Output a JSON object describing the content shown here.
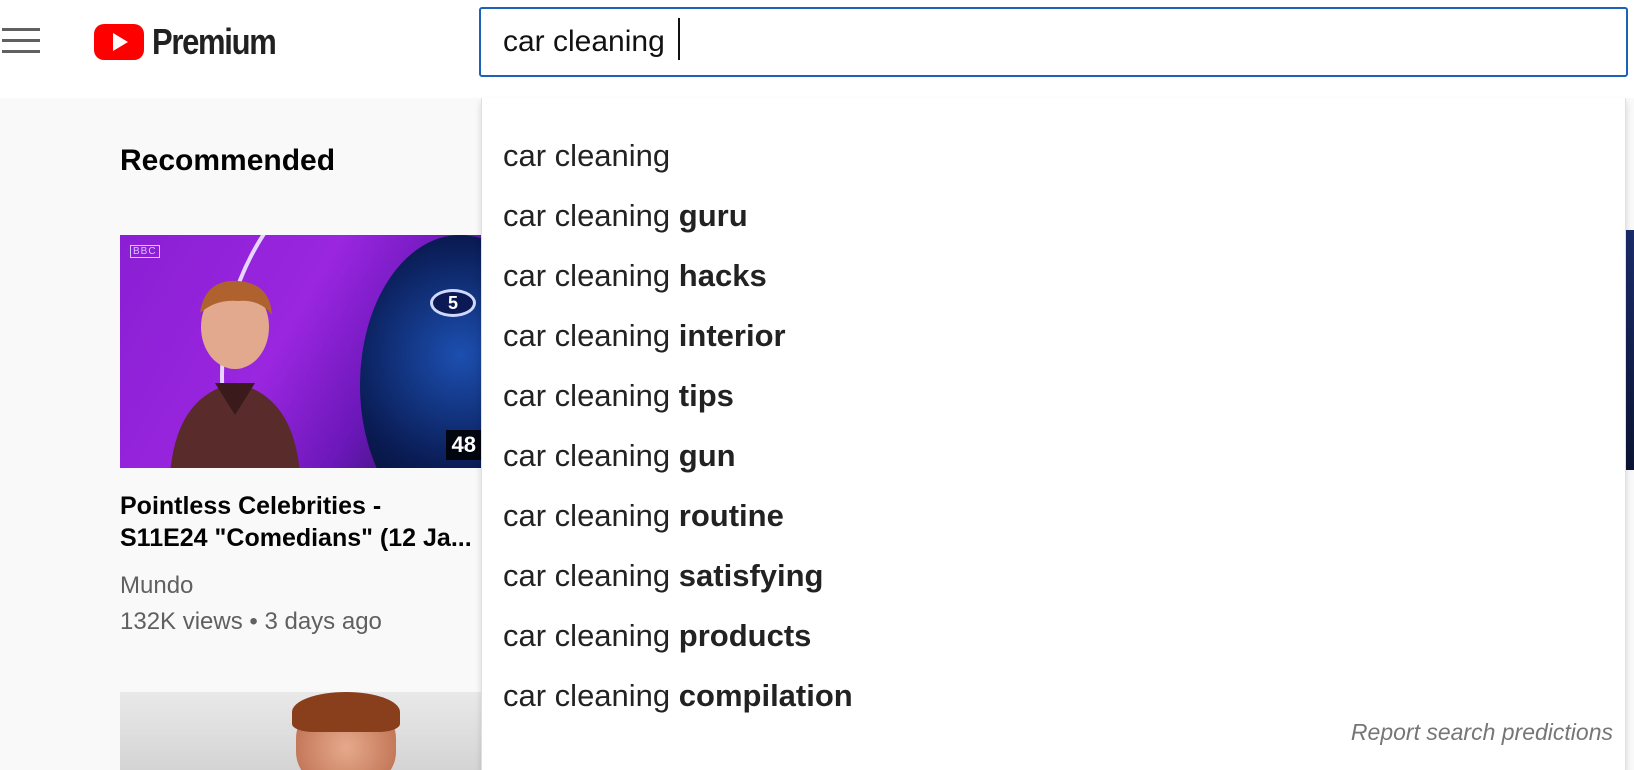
{
  "header": {
    "menu_icon": "hamburger-menu-icon",
    "logo_text": "Premium",
    "search": {
      "value": "car cleaning",
      "placeholder": ""
    }
  },
  "main": {
    "section_title": "Recommended",
    "videos": [
      {
        "title": "Pointless Celebrities - S11E24 \"Comedians\" (12 Ja...",
        "title_line1": "Pointless Celebrities -",
        "title_line2": "S11E24 \"Comedians\" (12 Ja...",
        "channel": "Mundo",
        "meta": "132K views • 3 days ago",
        "duration_partial": "48",
        "thumbnail_badge": "BBC",
        "thumbnail_score": "5"
      }
    ]
  },
  "dropdown": {
    "suggestions": [
      {
        "base": "car cleaning",
        "completion": ""
      },
      {
        "base": "car cleaning ",
        "completion": "guru"
      },
      {
        "base": "car cleaning ",
        "completion": "hacks"
      },
      {
        "base": "car cleaning ",
        "completion": "interior"
      },
      {
        "base": "car cleaning ",
        "completion": "tips"
      },
      {
        "base": "car cleaning ",
        "completion": "gun"
      },
      {
        "base": "car cleaning ",
        "completion": "routine"
      },
      {
        "base": "car cleaning ",
        "completion": "satisfying"
      },
      {
        "base": "car cleaning ",
        "completion": "products"
      },
      {
        "base": "car cleaning ",
        "completion": "compilation"
      }
    ],
    "report_label": "Report search predictions"
  },
  "colors": {
    "brand_red": "#ff0000",
    "search_border": "#1c62b9",
    "secondary_text": "#606060"
  }
}
